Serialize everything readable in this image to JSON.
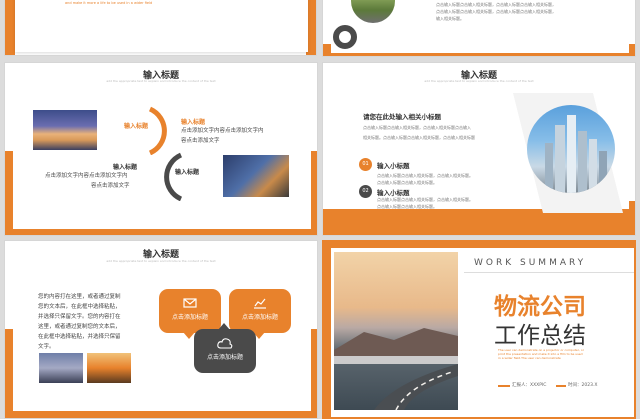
{
  "slide1": {
    "caption": "and make it more a life to be used in a wider field"
  },
  "slide2": {
    "list": [
      "点击输入标题点击输入相关标题，点击输入标题点击输入相关标题，",
      "点击输入标题点击输入相关标题，点击输入标题点击输入相关标题，",
      "输入相关标题。"
    ]
  },
  "slide3": {
    "title": "输入标题",
    "subtitle": "add the appropriate text to explain and introduce the content of the text",
    "item1": {
      "heading": "输入标题",
      "heading_right": "输入标题",
      "line1": "点击添加文字内容点击添加文字内",
      "line2": "容点击添加文字"
    },
    "item2": {
      "heading": "输入标题",
      "line1": "点击添加文字内容点击添加文字内",
      "line2": "容点击添加文字",
      "heading_right": "输入标题"
    }
  },
  "slide4": {
    "title": "输入标题",
    "subtitle": "add the appropriate text to explain and introduce the content of the text",
    "heading": "请您在此处输入相关小标题",
    "para": [
      "点击输入标题点击输入相关标题，点击输入相关标题点击输入",
      "相关标题。点击输入标题点击输入相关标题，点击输入相关标题"
    ],
    "items": [
      {
        "num": "01",
        "label": "输入小标题",
        "desc": [
          "点击输入标题点击输入相关标题，点击输入相关标题。",
          "点击输入标题点击输入相关标题。"
        ]
      },
      {
        "num": "02",
        "label": "输入小标题",
        "desc": [
          "点击输入标题点击输入相关标题，点击输入相关标题。",
          "点击输入标题点击输入相关标题。"
        ]
      }
    ]
  },
  "slide5": {
    "title": "输入标题",
    "subtitle": "add the appropriate text to explain and introduce the content of the text",
    "lines": [
      "您的内容打在这里，或者通过复制",
      "您的文本后，在此框中选择粘贴，",
      "并选择只保留文字。您的内容打在",
      "这里，或者通过复制您的文本后，",
      "在此框中选择粘贴，并选择只保留",
      "文字。"
    ],
    "bubbles": [
      "点击添加标题",
      "点击添加标题",
      "点击添加标题"
    ]
  },
  "slide6": {
    "header": "WORK  SUMMARY",
    "title1": "物流公司",
    "title2": "工作总结",
    "desc": [
      "The user can demonstrate on a projector or computer, or",
      "print the presentation and make it into a film to be used",
      "in a wider field.The user can demonstrate"
    ],
    "reporter": "汇报人：XXXPIC",
    "time": "时间：2023.X",
    "colors": {
      "accent": "#e8822c",
      "dark": "#4a4a4a"
    }
  }
}
